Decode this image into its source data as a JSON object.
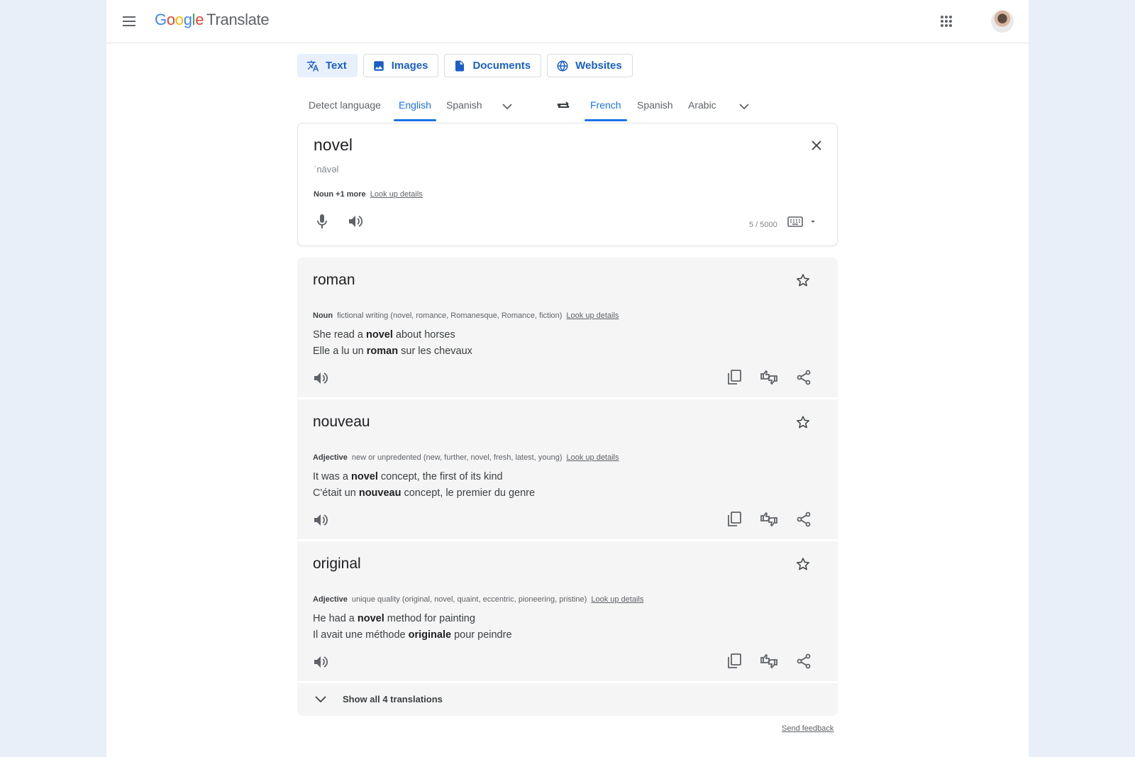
{
  "header": {
    "logo_parts": [
      "G",
      "o",
      "o",
      "g",
      "l",
      "e"
    ],
    "product": "Translate",
    "menu_icon": "hamburger-menu-icon",
    "apps_icon": "apps-grid-icon",
    "avatar": "user-avatar"
  },
  "modes": [
    {
      "label": "Text",
      "icon": "translate-icon",
      "active": true
    },
    {
      "label": "Images",
      "icon": "image-icon",
      "active": false
    },
    {
      "label": "Documents",
      "icon": "document-icon",
      "active": false
    },
    {
      "label": "Websites",
      "icon": "globe-icon",
      "active": false
    }
  ],
  "source_langs": [
    {
      "label": "Detect language",
      "active": false
    },
    {
      "label": "English",
      "active": true
    },
    {
      "label": "Spanish",
      "active": false
    }
  ],
  "target_langs": [
    {
      "label": "French",
      "active": true
    },
    {
      "label": "Spanish",
      "active": false
    },
    {
      "label": "Arabic",
      "active": false
    }
  ],
  "source": {
    "text": "novel",
    "phonetic": "ˈnävəl",
    "pos": "Noun +1 more",
    "lookup": "Look up details",
    "char_count": "5 / 5000"
  },
  "translations": [
    {
      "word": "roman",
      "pos": "Noun",
      "gloss": "fictional writing (novel, romance, Romanesque, Romance, fiction)",
      "lookup": "Look up details",
      "example_src": [
        "She read a ",
        "novel",
        " about horses"
      ],
      "example_tgt": [
        "Elle a lu un ",
        "roman",
        " sur les chevaux"
      ]
    },
    {
      "word": "nouveau",
      "pos": "Adjective",
      "gloss": "new or unpredented (new, further, novel, fresh, latest, young)",
      "lookup": "Look up details",
      "example_src": [
        "It was a ",
        "novel",
        " concept, the first of its kind"
      ],
      "example_tgt": [
        "C'était un ",
        "nouveau",
        " concept, le premier du genre"
      ]
    },
    {
      "word": "original",
      "pos": "Adjective",
      "gloss": "unique quality (original, novel, quaint, eccentric, pioneering, pristine)",
      "lookup": "Look up details",
      "example_src": [
        "He had a ",
        "novel",
        " method for painting"
      ],
      "example_tgt": [
        "Il avait une méthode ",
        "originale",
        " pour peindre"
      ]
    }
  ],
  "show_all": "Show all 4 translations",
  "feedback": "Send feedback",
  "colors": {
    "accent": "#1a73e8",
    "card_bg": "#f5f5f5",
    "outer_bg": "#e8eff9"
  }
}
